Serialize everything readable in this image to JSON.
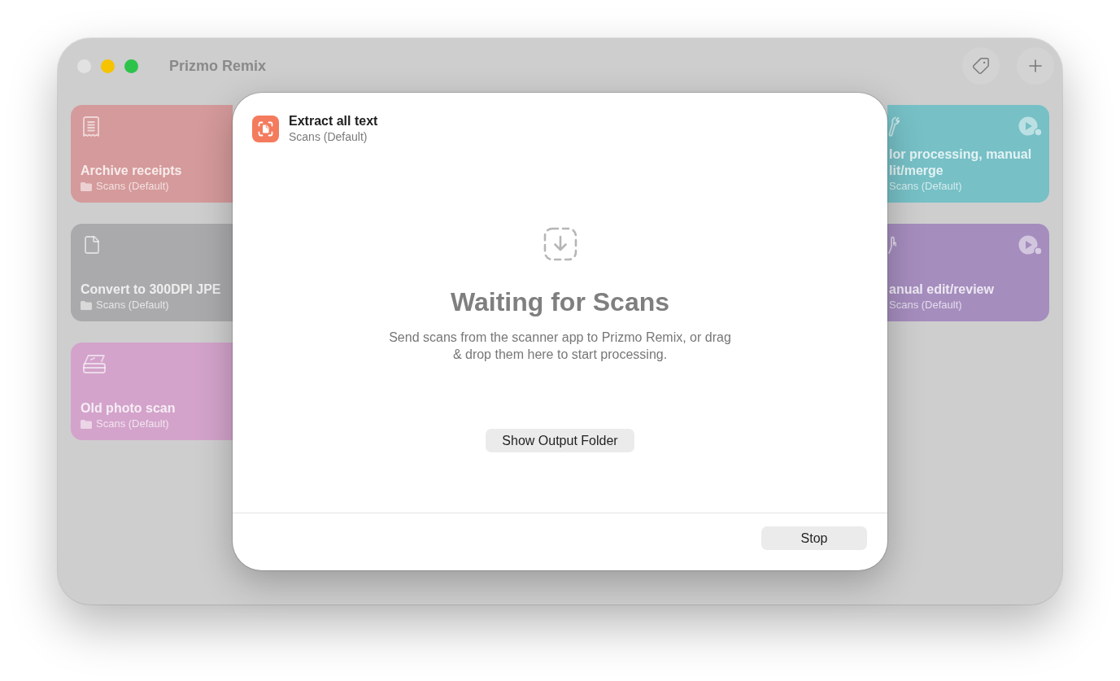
{
  "window": {
    "title": "Prizmo Remix"
  },
  "workflows": {
    "left_column": [
      {
        "title": "Archive receipts",
        "folder": "Scans (Default)",
        "color": "#d59a9b"
      },
      {
        "title": "Convert to 300DPI JPE",
        "folder": "Scans (Default)",
        "color": "#aaaaac"
      },
      {
        "title": "Old photo scan",
        "folder": "Scans (Default)",
        "color": "#d3a3cb"
      }
    ],
    "right_column": [
      {
        "title": "lor processing, manual lit/merge",
        "folder": "Scans (Default)",
        "color": "#76c0c6"
      },
      {
        "title": "anual edit/review",
        "folder": "Scans (Default)",
        "color": "#a58dbe"
      }
    ]
  },
  "sheet": {
    "workflow_title": "Extract all text",
    "workflow_folder": "Scans (Default)",
    "heading": "Waiting for Scans",
    "message": "Send scans from the scanner app to Prizmo Remix, or drag & drop them here to start processing.",
    "show_folder_button": "Show Output Folder",
    "stop_button": "Stop"
  }
}
